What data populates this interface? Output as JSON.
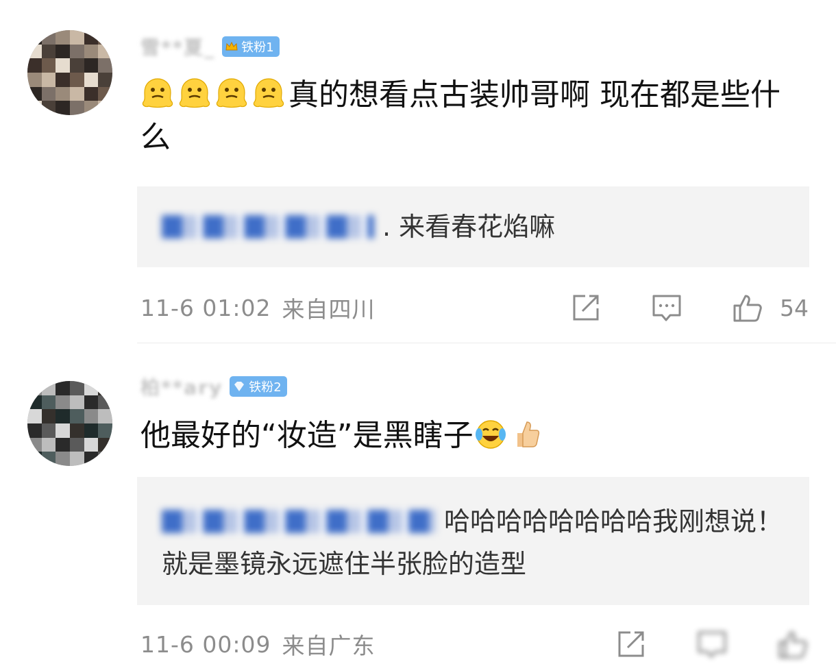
{
  "comments": [
    {
      "username": "雪**夏_",
      "fan_badge": "铁粉1",
      "emoji_count": 4,
      "emoji_icon": "melting-face-icon",
      "text": "真的想看点古装帅哥啊 现在都是些什么",
      "reply": {
        "text": ". 来看春花焰嘛"
      },
      "time": "11-6 01:02",
      "location": "来自四川",
      "likes": "54"
    },
    {
      "username": "柏**ary",
      "fan_badge": "铁粉2",
      "text": "他最好的“妆造”是黑瞎子",
      "trailing_emojis": [
        "laughing-crying-icon",
        "thumbs-up-icon"
      ],
      "reply": {
        "text": "哈哈哈哈哈哈哈哈我刚想说！就是墨镜永远遮住半张脸的造型"
      },
      "time": "11-6 00:09",
      "location": "来自广东"
    }
  ],
  "colors": {
    "badge_blue": "#6fb3f0",
    "meta_gray": "#8c8c8c",
    "reply_bg": "#f3f3f3"
  }
}
